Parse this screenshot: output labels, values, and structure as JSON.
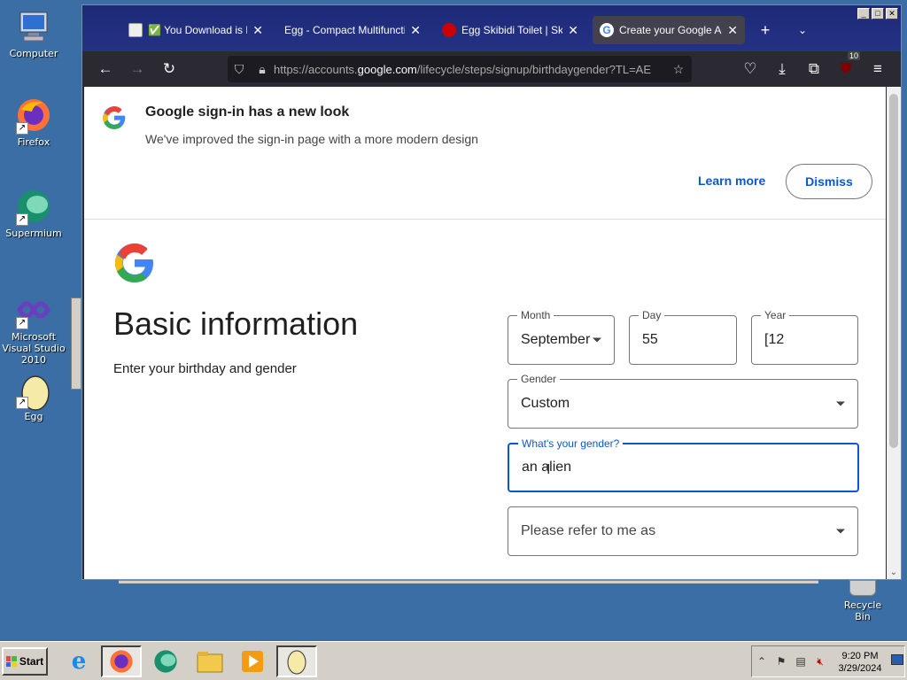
{
  "desktop": {
    "icons": [
      {
        "label": "Computer"
      },
      {
        "label": "Firefox"
      },
      {
        "label": "Supermium"
      },
      {
        "label": "Microsoft Visual Studio 2010"
      },
      {
        "label": "Egg"
      }
    ],
    "recycle_bin": "Recycle Bin"
  },
  "browser": {
    "tabs": [
      {
        "title": "✅ You Download is Read"
      },
      {
        "title": "Egg - Compact Multifunction T"
      },
      {
        "title": "Egg Skibidi Toilet | Skibidi"
      },
      {
        "title": "Create your Google Acc"
      }
    ],
    "url_prefix": "https://accounts.",
    "url_domain": "google.com",
    "url_path": "/lifecycle/steps/signup/birthdaygender?TL=AE",
    "extension_badge": "10"
  },
  "banner": {
    "title": "Google sign-in has a new look",
    "description": "We've improved the sign-in page with a more modern design",
    "learn_more": "Learn more",
    "dismiss": "Dismiss"
  },
  "form": {
    "title": "Basic information",
    "subtitle": "Enter your birthday and gender",
    "month_label": "Month",
    "month_value": "September",
    "day_label": "Day",
    "day_value": "55",
    "year_label": "Year",
    "year_value": "[12",
    "gender_label": "Gender",
    "gender_value": "Custom",
    "custom_label": "What's your gender?",
    "custom_value": "an alien",
    "pronoun_placeholder": "Please refer to me as"
  },
  "taskbar": {
    "start": "Start",
    "time": "9:20 PM",
    "date": "3/29/2024"
  },
  "colors": {
    "desktop": "#3a6ea5",
    "accent_blue": "#0b57d0"
  }
}
